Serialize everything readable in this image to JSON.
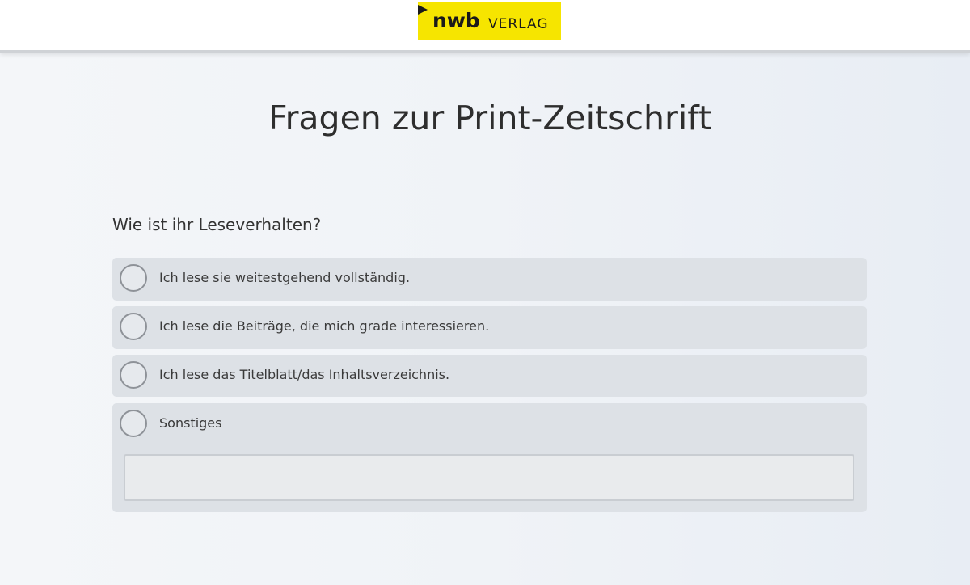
{
  "header": {
    "logo": {
      "mark": "nwb",
      "word": "VERLAG",
      "brand_color": "#f6e500"
    }
  },
  "main": {
    "title": "Fragen zur Print-Zeitschrift",
    "question": "Wie ist ihr Leseverhalten?",
    "options": [
      {
        "label": "Ich lese sie weitestgehend vollständig.",
        "selected": false
      },
      {
        "label": "Ich lese die Beiträge, die mich grade interessieren.",
        "selected": false
      },
      {
        "label": "Ich lese das Titelblatt/das Inhaltsverzeichnis.",
        "selected": false
      },
      {
        "label": "Sonstiges",
        "selected": false
      }
    ],
    "other_input": {
      "value": "",
      "placeholder": ""
    }
  },
  "colors": {
    "option_background": "#dde1e6",
    "radio_border": "#8e9298",
    "text": "#3a3a3a"
  }
}
